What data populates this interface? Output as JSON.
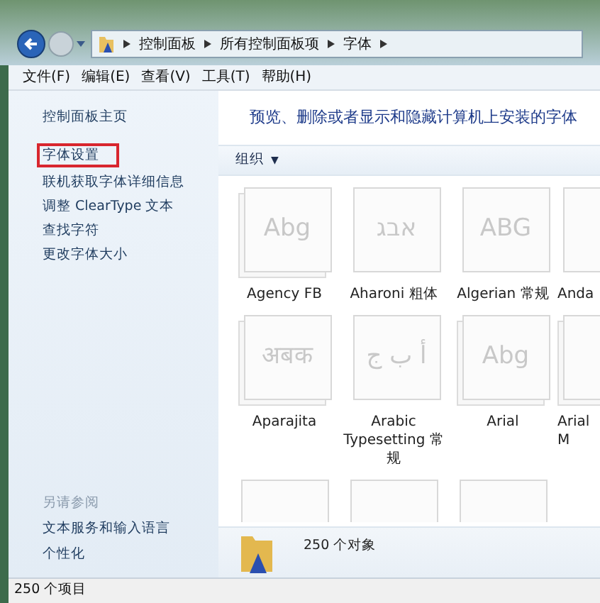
{
  "breadcrumb": [
    {
      "label": "控制面板"
    },
    {
      "label": "所有控制面板项"
    },
    {
      "label": "字体"
    }
  ],
  "menu": [
    "文件(F)",
    "编辑(E)",
    "查看(V)",
    "工具(T)",
    "帮助(H)"
  ],
  "sidebar": {
    "items": [
      {
        "label": "控制面板主页",
        "selected": false
      },
      {
        "label": "字体设置",
        "selected": true
      },
      {
        "label": "联机获取字体详细信息",
        "selected": false
      },
      {
        "label": "调整 ClearType 文本",
        "selected": false
      },
      {
        "label": "查找字符",
        "selected": false
      },
      {
        "label": "更改字体大小",
        "selected": false
      }
    ],
    "see_also": {
      "title": "另请参阅",
      "items": [
        "文本服务和输入语言",
        "个性化"
      ]
    }
  },
  "heading": "预览、删除或者显示和隐藏计算机上安装的字体",
  "toolbar": {
    "organize": "组织",
    "caret": "▼"
  },
  "fonts": [
    {
      "name": "Agency FB",
      "sample": "Abg",
      "stacked": true
    },
    {
      "name": "Aharoni 粗体",
      "sample": "אבג",
      "stacked": false
    },
    {
      "name": "Algerian 常规",
      "sample": "ABG",
      "stacked": false
    },
    {
      "name": "Anda",
      "stacked": false
    },
    {
      "name": "Aparajita",
      "sample": "अबक",
      "stacked": true
    },
    {
      "name": "Arabic Typesetting 常规",
      "sample": "أ ب ج",
      "stacked": false
    },
    {
      "name": "Arial",
      "sample": "Abg",
      "stacked": true
    },
    {
      "name": "Arial M",
      "stacked": true
    }
  ],
  "details": {
    "count": "250 个对象"
  },
  "status_bar": "250 个项目"
}
